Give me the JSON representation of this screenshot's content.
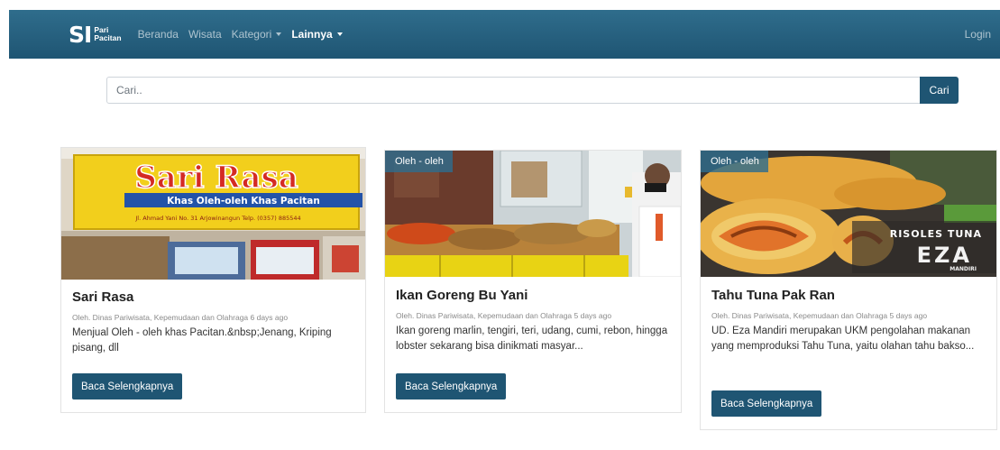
{
  "navbar": {
    "brand_mark": "SI",
    "brand_line1": "Pari",
    "brand_line2": "Pacitan",
    "links": [
      {
        "label": "Beranda"
      },
      {
        "label": "Wisata"
      },
      {
        "label": "Kategori"
      },
      {
        "label": "Lainnya"
      }
    ],
    "login": "Login"
  },
  "search": {
    "placeholder": "Cari..",
    "button": "Cari"
  },
  "cards": [
    {
      "image_sign_line1": "Sari Rasa",
      "image_sign_line2": "Khas Oleh-oleh Khas Pacitan",
      "image_sign_line3": "Jl. Ahmad Yani No. 31 Arjowinangun Telp. (0357) 885544",
      "title": "Sari Rasa",
      "meta": "Oleh. Dinas Pariwisata, Kepemudaan dan Olahraga 6 days ago",
      "text": "Menjual Oleh - oleh khas Pacitan.&nbsp;Jenang, Kriping pisang, dll",
      "button": "Baca Selengkapnya"
    },
    {
      "badge": "Oleh - oleh",
      "title": "Ikan Goreng Bu Yani",
      "meta": "Oleh. Dinas Pariwisata, Kepemudaan dan Olahraga 5 days ago",
      "text": "Ikan goreng marlin, tengiri, teri, udang, cumi, rebon, hingga lobster sekarang bisa dinikmati masyar...",
      "button": "Baca Selengkapnya"
    },
    {
      "badge": "Oleh - oleh",
      "image_text_line1": "RISOLES TUNA",
      "image_text_line2": "EZA",
      "image_text_line3": "MANDIRI",
      "title": "Tahu Tuna Pak Ran",
      "meta": "Oleh. Dinas Pariwisata, Kepemudaan dan Olahraga 5 days ago",
      "text": "UD. Eza Mandiri merupakan UKM pengolahan makanan yang memproduksi Tahu Tuna, yaitu olahan tahu bakso...",
      "button": "Baca Selengkapnya"
    }
  ]
}
